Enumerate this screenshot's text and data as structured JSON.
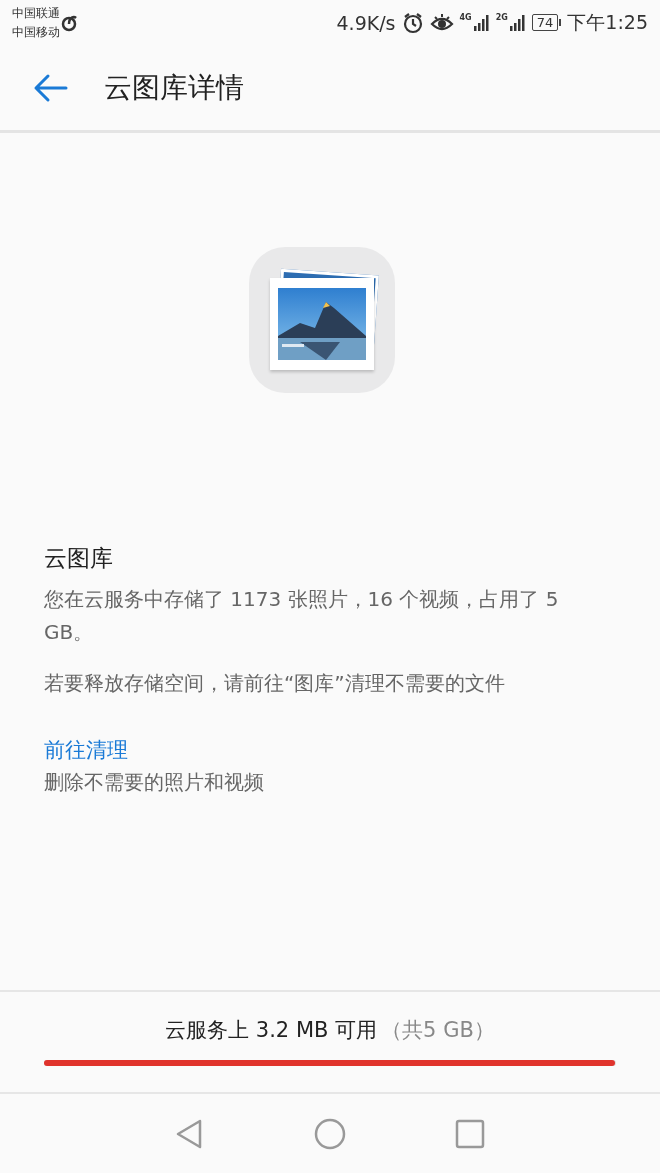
{
  "status_bar": {
    "carriers": [
      "中国联通",
      "中国移动"
    ],
    "speed": "4.9K/s",
    "networks": [
      {
        "label": "4G"
      },
      {
        "label": "2G"
      }
    ],
    "battery": "74",
    "time": "下午1:25"
  },
  "app_bar": {
    "title": "云图库详情"
  },
  "content": {
    "heading": "云图库",
    "description": "您在云服务中存储了 1173 张照片，16 个视频，占用了 5 GB。",
    "hint": "若要释放存储空间，请前往“图库”清理不需要的文件",
    "link": "前往清理",
    "link_caption": "删除不需要的照片和视频"
  },
  "storage": {
    "available": "云服务上 3.2 MB 可用",
    "total": "（共5 GB）",
    "level": 0.999
  }
}
